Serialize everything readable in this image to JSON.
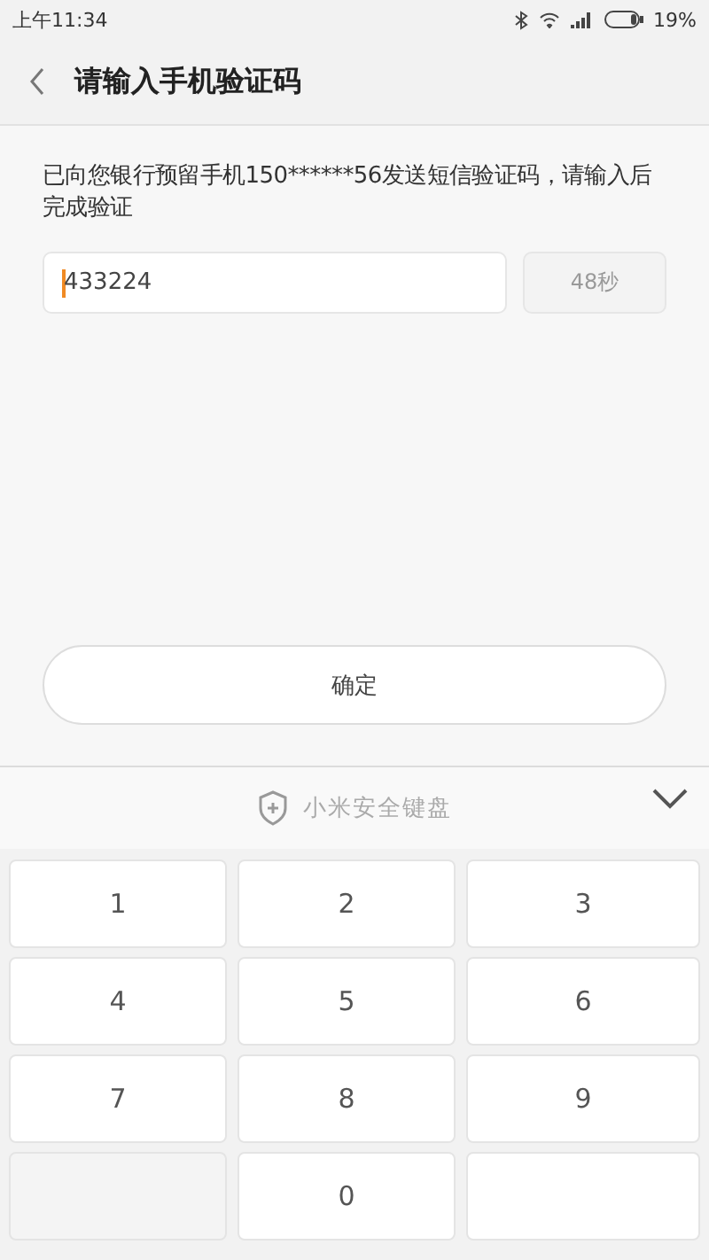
{
  "status_bar": {
    "time": "上午11:34",
    "battery": "19%"
  },
  "header": {
    "title": "请输入手机验证码"
  },
  "message": "已向您银行预留手机150******56发送短信验证码，请输入后完成验证",
  "code_field": {
    "value": "433224"
  },
  "countdown": {
    "label": "48秒",
    "disabled": true
  },
  "confirm_button": {
    "label": "确定"
  },
  "keyboard": {
    "title": "小米安全键盘",
    "keys": [
      {
        "kind": "digit",
        "label": "1"
      },
      {
        "kind": "digit",
        "label": "2"
      },
      {
        "kind": "digit",
        "label": "3"
      },
      {
        "kind": "digit",
        "label": "4"
      },
      {
        "kind": "digit",
        "label": "5"
      },
      {
        "kind": "digit",
        "label": "6"
      },
      {
        "kind": "digit",
        "label": "7"
      },
      {
        "kind": "digit",
        "label": "8"
      },
      {
        "kind": "digit",
        "label": "9"
      },
      {
        "kind": "blank"
      },
      {
        "kind": "digit",
        "label": "0"
      },
      {
        "kind": "plain"
      }
    ]
  }
}
